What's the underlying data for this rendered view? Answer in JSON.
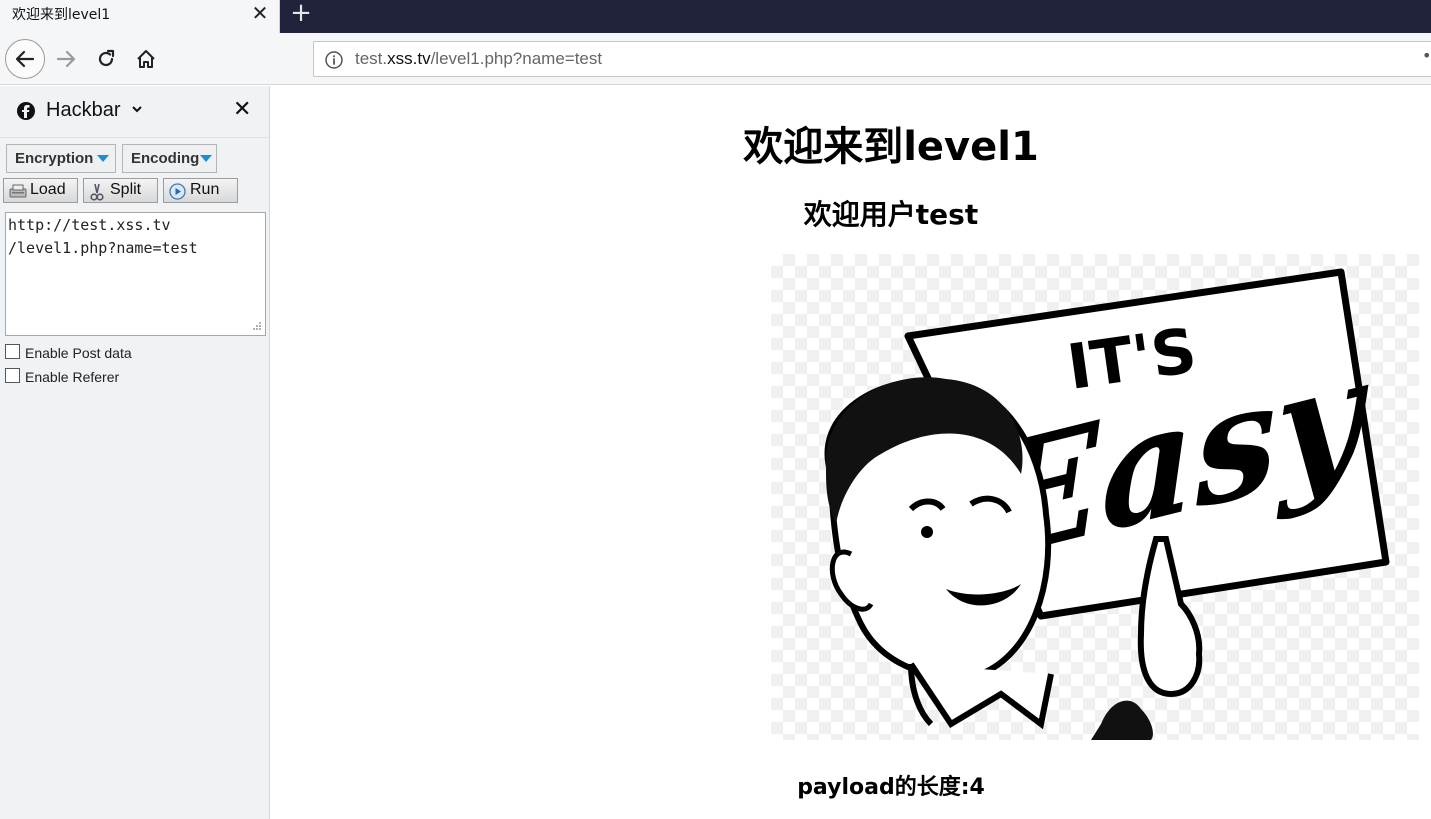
{
  "browser": {
    "tab_title": "欢迎来到level1",
    "url_prefix": "test.",
    "url_domain": "xss.tv",
    "url_path": "/level1.php?name=test"
  },
  "hackbar": {
    "title": "Hackbar",
    "encryption_label": "Encryption",
    "encoding_label": "Encoding",
    "load_label": "Load",
    "split_label": "Split",
    "run_label": "Run",
    "url_value": "http://test.xss.tv\n/level1.php?name=test",
    "post_label": "Enable Post data",
    "referer_label": "Enable Referer"
  },
  "page": {
    "heading": "欢迎来到level1",
    "subheading": "欢迎用户test",
    "image_text_top": "IT'S",
    "image_text_main": "Easy",
    "payload_length": "payload的长度:4"
  },
  "colors": {
    "tabstrip": "#20233b",
    "accent": "#1d8ed1"
  }
}
